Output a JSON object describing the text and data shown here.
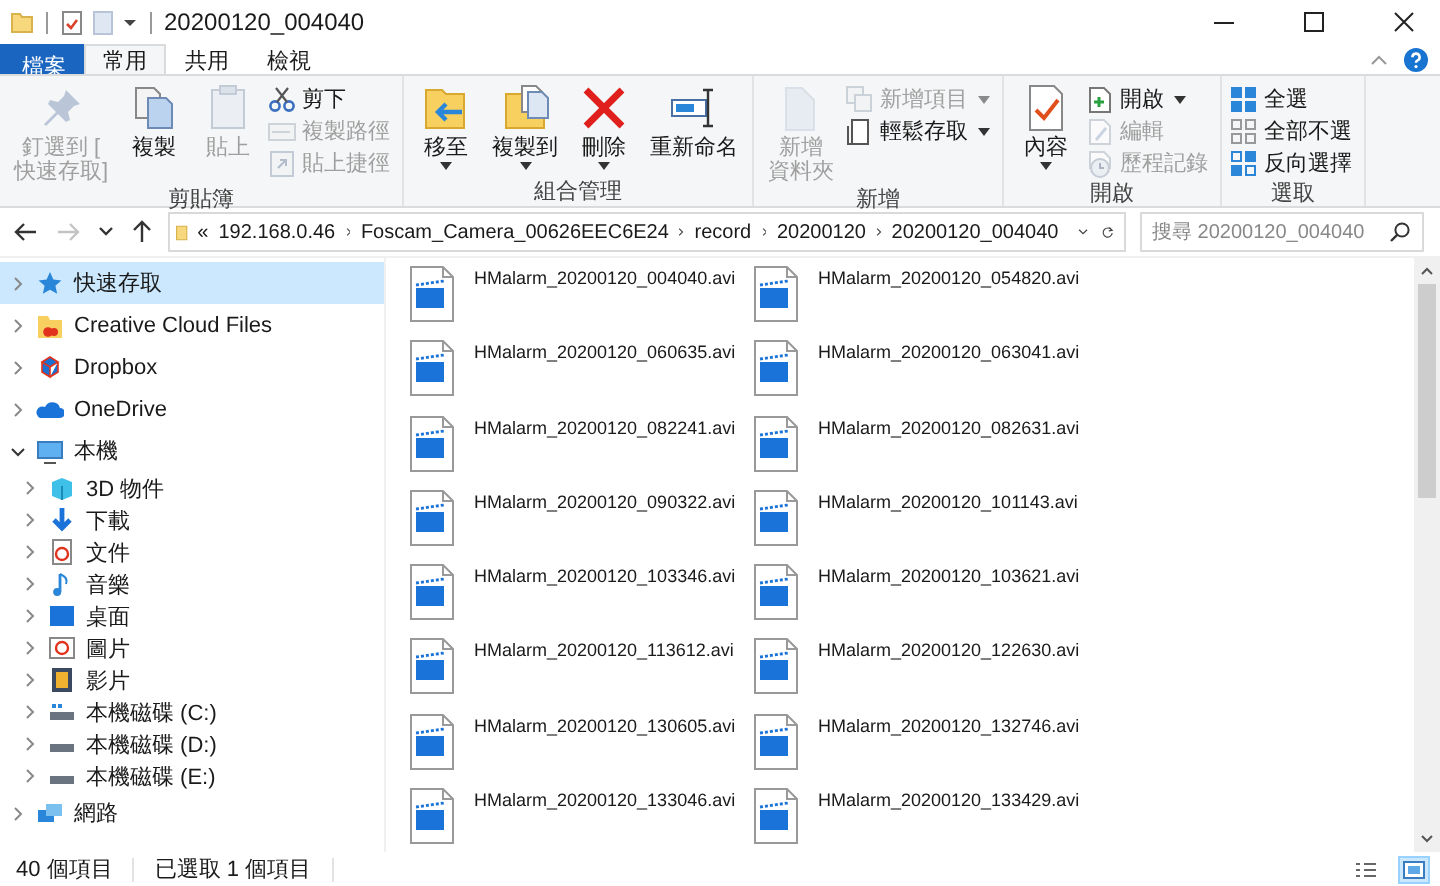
{
  "window": {
    "title": "20200120_004040"
  },
  "ribbon": {
    "tabs": [
      {
        "label": "檔案",
        "kind": "file",
        "selected": false
      },
      {
        "label": "常用",
        "kind": "tab",
        "selected": true
      },
      {
        "label": "共用",
        "kind": "tab",
        "selected": false
      },
      {
        "label": "檢視",
        "kind": "tab",
        "selected": false
      }
    ],
    "groups": [
      {
        "label": "剪貼簿",
        "commands": [
          {
            "kind": "large",
            "lines": [
              "釘選到 [",
              "快速存取]"
            ],
            "disabled": true,
            "menu": false
          },
          {
            "kind": "large",
            "lines": [
              "複製"
            ],
            "disabled": false,
            "menu": false
          },
          {
            "kind": "large",
            "lines": [
              "貼上"
            ],
            "disabled": true,
            "menu": false
          },
          {
            "kind": "small",
            "lines": [
              "剪下"
            ],
            "disabled": false,
            "menu": false
          },
          {
            "kind": "small",
            "lines": [
              "複製路徑"
            ],
            "disabled": true,
            "menu": false
          },
          {
            "kind": "small",
            "lines": [
              "貼上捷徑"
            ],
            "disabled": true,
            "menu": false
          }
        ]
      },
      {
        "label": "組合管理",
        "commands": [
          {
            "kind": "large",
            "lines": [
              "移至"
            ],
            "disabled": false,
            "menu": true
          },
          {
            "kind": "large",
            "lines": [
              "複製到"
            ],
            "disabled": false,
            "menu": true
          },
          {
            "kind": "large",
            "lines": [
              "刪除"
            ],
            "disabled": false,
            "menu": true
          },
          {
            "kind": "large",
            "lines": [
              "重新命名"
            ],
            "disabled": false,
            "menu": false
          }
        ]
      },
      {
        "label": "新增",
        "commands": [
          {
            "kind": "large",
            "lines": [
              "新增",
              "資料夾"
            ],
            "disabled": true,
            "menu": false
          },
          {
            "kind": "small",
            "lines": [
              "新增項目"
            ],
            "disabled": true,
            "menu": true
          },
          {
            "kind": "small",
            "lines": [
              "輕鬆存取"
            ],
            "disabled": false,
            "menu": true
          }
        ]
      },
      {
        "label": "開啟",
        "commands": [
          {
            "kind": "large",
            "lines": [
              "內容"
            ],
            "disabled": false,
            "menu": true
          },
          {
            "kind": "small",
            "lines": [
              "開啟"
            ],
            "disabled": false,
            "menu": true
          },
          {
            "kind": "small",
            "lines": [
              "編輯"
            ],
            "disabled": true,
            "menu": false
          },
          {
            "kind": "small",
            "lines": [
              "歷程記錄"
            ],
            "disabled": true,
            "menu": false
          }
        ]
      },
      {
        "label": "選取",
        "commands": [
          {
            "kind": "small",
            "lines": [
              "全選"
            ],
            "disabled": false,
            "menu": false
          },
          {
            "kind": "small",
            "lines": [
              "全部不選"
            ],
            "disabled": false,
            "menu": false
          },
          {
            "kind": "small",
            "lines": [
              "反向選擇"
            ],
            "disabled": false,
            "menu": false
          }
        ]
      }
    ]
  },
  "nav": [
    {
      "kind": "back",
      "disabled": false
    },
    {
      "kind": "forward",
      "disabled": true
    },
    {
      "kind": "recent",
      "disabled": false
    },
    {
      "kind": "up",
      "disabled": false
    }
  ],
  "address": {
    "overflow": "«",
    "crumbs": [
      "192.168.0.46",
      "Foscam_Camera_00626EEC6E24",
      "record",
      "20200120",
      "20200120_004040"
    ]
  },
  "search": {
    "placeholder": "搜尋 20200120_004040"
  },
  "sidebar": {
    "items": [
      {
        "label": "快速存取",
        "expanded": false,
        "selected": true
      },
      {
        "label": "Creative Cloud Files",
        "expanded": false,
        "selected": false
      },
      {
        "label": "Dropbox",
        "expanded": false,
        "selected": false
      },
      {
        "label": "OneDrive",
        "expanded": false,
        "selected": false
      },
      {
        "label": "本機",
        "expanded": true,
        "selected": false,
        "children": [
          {
            "label": "3D 物件",
            "expanded": false,
            "selected": false
          },
          {
            "label": "下載",
            "expanded": false,
            "selected": false
          },
          {
            "label": "文件",
            "expanded": false,
            "selected": false
          },
          {
            "label": "音樂",
            "expanded": false,
            "selected": false
          },
          {
            "label": "桌面",
            "expanded": false,
            "selected": false
          },
          {
            "label": "圖片",
            "expanded": false,
            "selected": false
          },
          {
            "label": "影片",
            "expanded": false,
            "selected": false
          },
          {
            "label": "本機磁碟 (C:)",
            "expanded": false,
            "selected": false
          },
          {
            "label": "本機磁碟 (D:)",
            "expanded": false,
            "selected": false
          },
          {
            "label": "本機磁碟 (E:)",
            "expanded": false,
            "selected": false
          }
        ]
      },
      {
        "label": "網路",
        "expanded": false,
        "selected": false
      }
    ]
  },
  "files": [
    "HMalarm_20200120_004040.avi",
    "HMalarm_20200120_054820.avi",
    "HMalarm_20200120_060635.avi",
    "HMalarm_20200120_063041.avi",
    "HMalarm_20200120_082241.avi",
    "HMalarm_20200120_082631.avi",
    "HMalarm_20200120_090322.avi",
    "HMalarm_20200120_101143.avi",
    "HMalarm_20200120_103346.avi",
    "HMalarm_20200120_103621.avi",
    "HMalarm_20200120_113612.avi",
    "HMalarm_20200120_122630.avi",
    "HMalarm_20200120_130605.avi",
    "HMalarm_20200120_132746.avi",
    "HMalarm_20200120_133046.avi",
    "HMalarm_20200120_133429.avi"
  ],
  "status_bar": {
    "count": "40 個項目",
    "selection": "已選取 1 個項目",
    "views": [
      {
        "kind": "details",
        "selected": false
      },
      {
        "kind": "large",
        "selected": true
      }
    ]
  }
}
